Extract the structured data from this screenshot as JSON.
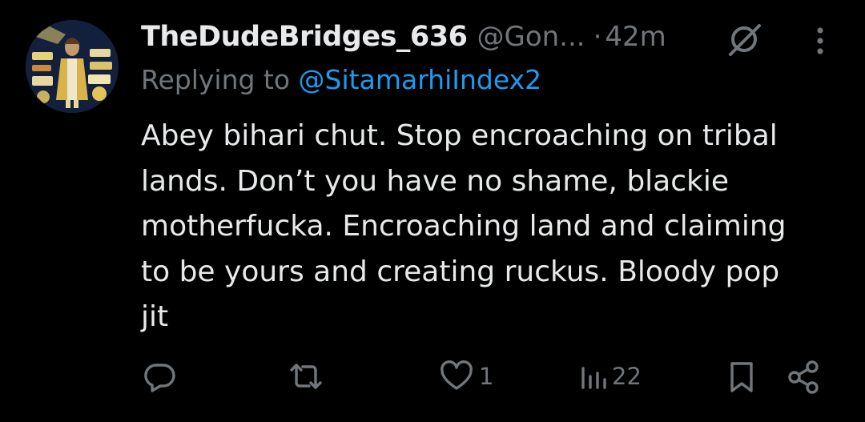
{
  "tweet": {
    "display_name": "TheDudeBridges_636",
    "handle": "@Gon...",
    "separator": "·",
    "time": "42m",
    "reply_prefix": "Replying to ",
    "reply_handle": "@SitamarhiIndex2",
    "text_lines": [
      "Abey bihari chut. Stop encroaching on tribal",
      "lands. Don’t you have no shame, blackie",
      "motherfucka. Encroaching land and claiming",
      "to be yours and creating ruckus. Bloody pop",
      "jit"
    ]
  },
  "actions": {
    "reply_count": "",
    "repost_count": "",
    "like_count": "1",
    "views_count": "22"
  },
  "icons": {
    "reply": "reply-icon",
    "repost": "repost-icon",
    "like": "heart-icon",
    "views": "views-icon",
    "bookmark": "bookmark-icon",
    "share": "share-icon",
    "grok": "grok-icon",
    "more": "more-vertical-icon"
  },
  "colors": {
    "background": "#000000",
    "text": "#e7e9ea",
    "muted": "#71767b",
    "link": "#1d9bf0"
  }
}
